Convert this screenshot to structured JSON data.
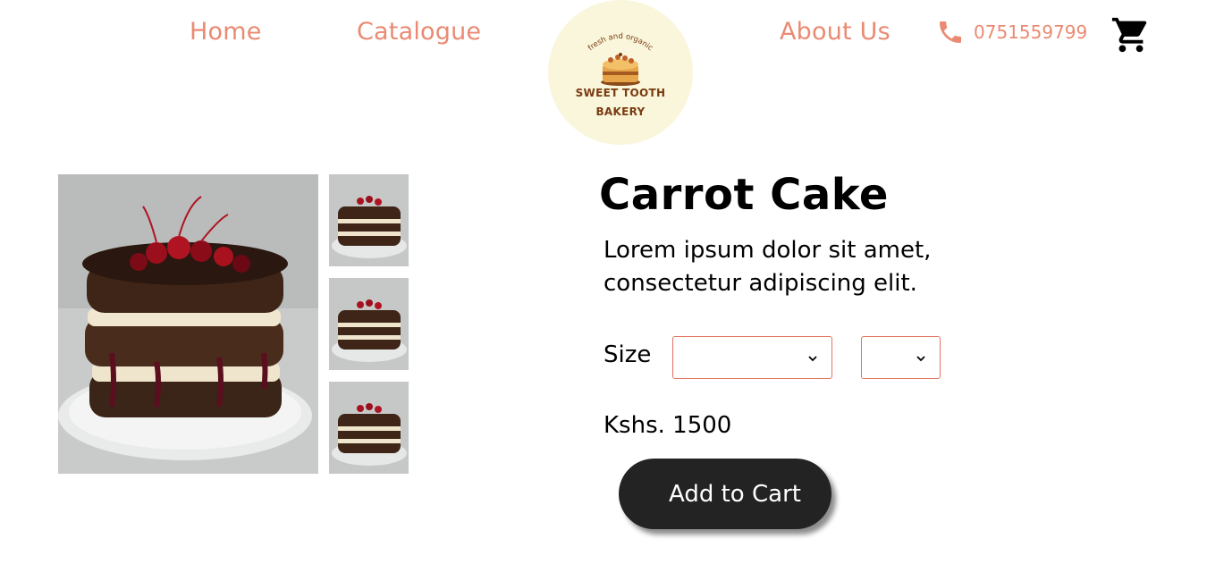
{
  "nav": {
    "home": "Home",
    "catalogue": "Catalogue",
    "about": "About Us",
    "phone": "0751559799"
  },
  "logo": {
    "tagline": "fresh and organic",
    "name_line1": "SWEET TOOTH",
    "name_line2": "BAKERY"
  },
  "product": {
    "title": "Carrot Cake",
    "description": "Lorem ipsum dolor sit amet, consectetur adipiscing elit.",
    "size_label": "Size",
    "size_value": "",
    "qty_value": "",
    "price": "Kshs. 1500",
    "add_to_cart": "Add to Cart"
  },
  "colors": {
    "accent": "#ea8a72",
    "button": "#232323",
    "logo_bg": "#f9f6dc"
  },
  "icons": {
    "phone": "phone-icon",
    "cart": "cart-icon",
    "chevron": "chevron-down-icon"
  }
}
